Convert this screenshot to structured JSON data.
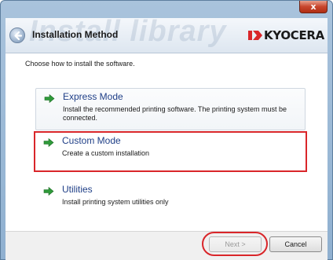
{
  "window": {
    "close_glyph": "x",
    "header_title": "Installation Method",
    "watermark_text": "Install library",
    "logo_text": "KYOCERA",
    "accent_red": "#d9262a",
    "option_blue": "#1f3f87"
  },
  "main": {
    "instruction": "Choose how to install the software.",
    "options": [
      {
        "title": "Express Mode",
        "description": "Install the recommended printing software. The printing system must be connected.",
        "icon": "green-arrow-icon"
      },
      {
        "title": "Custom Mode",
        "description": "Create a custom installation",
        "icon": "green-arrow-icon",
        "highlighted": true
      },
      {
        "title": "Utilities",
        "description": "Install printing system utilities only",
        "icon": "green-arrow-icon"
      }
    ]
  },
  "footer": {
    "next_label": "Next >",
    "cancel_label": "Cancel"
  }
}
